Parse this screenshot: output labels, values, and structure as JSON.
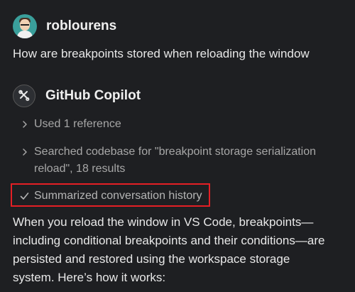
{
  "user": {
    "name": "roblourens",
    "question": "How are breakpoints stored when reloading the window"
  },
  "copilot": {
    "name": "GitHub Copilot",
    "references": "Used 1 reference",
    "search": {
      "line1": "Searched codebase for \"breakpoint storage serialization",
      "line2": "reload\", 18 results"
    },
    "summary": "Summarized conversation history",
    "answer": {
      "line1": "When you reload the window in VS Code, breakpoints—",
      "line2": "including conditional breakpoints and their conditions—are",
      "line3": "persisted and restored using the workspace storage",
      "line4": "system. Here’s how it works:"
    }
  },
  "icons": {
    "user_avatar": "user-avatar-icon",
    "copilot_avatar": "tools-icon",
    "collapsed": "chevron-right-icon",
    "done": "check-icon"
  },
  "colors": {
    "background": "#1e1f22",
    "highlight": "#e41f25",
    "avatar": "#3a9f9b"
  }
}
